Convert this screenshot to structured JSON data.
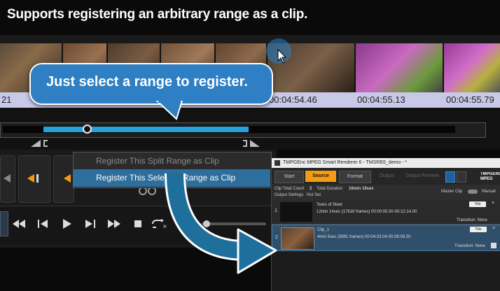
{
  "headline": "Supports registering an arbitrary range as a clip.",
  "callout": "Just select a range to register.",
  "timecodes": [
    "21",
    "00:04:54.46",
    "00:04:55.13",
    "00:04:55.79"
  ],
  "context_menu": {
    "items": [
      {
        "label": "Register This Split Range as Clip",
        "enabled": false
      },
      {
        "label": "Register This Selected Range as Clip",
        "enabled": true,
        "highlighted": true
      }
    ]
  },
  "range_selection": {
    "start_fraction": 0.09,
    "end_fraction": 0.55,
    "playhead_fraction": 0.18
  },
  "app_window": {
    "title": "TMPGEnc MPEG Smart Renderer 6 - TMSRE6_demo - *",
    "tabs": [
      "Start",
      "Source",
      "Format",
      "Output",
      "Output Preview"
    ],
    "active_tab": "Source",
    "brand": "TMPGENC MPEG",
    "clip_total_count_label": "Clip Total Count",
    "clip_total_count": "2",
    "total_duration_label": "Total Duration",
    "total_duration": "16min 19sec",
    "output_settings_label": "Output Settings",
    "output_settings": "Not Set",
    "master_clip_label": "Master Clip",
    "manual_label": "Manual",
    "clips": [
      {
        "index": "1",
        "name": "Tears of Steel",
        "details": "12min 14sec (17616 frames) 00:00:00.00-00:12:14.00",
        "transition": "Transition: None",
        "title_btn": "Title"
      },
      {
        "index": "2",
        "name": "Clip_1",
        "details": "4min 5sec (5891 frames) 00:04:03.04-00:08:08.50",
        "transition": "Transition: None",
        "title_btn": "Title"
      }
    ]
  },
  "colors": {
    "accent_blue": "#2e7fc4",
    "selection_blue": "#2aa0d8",
    "menu_highlight": "#2d6e9c",
    "source_tab_orange": "#f39c12",
    "arrow_teal": "#1f6f9c"
  }
}
